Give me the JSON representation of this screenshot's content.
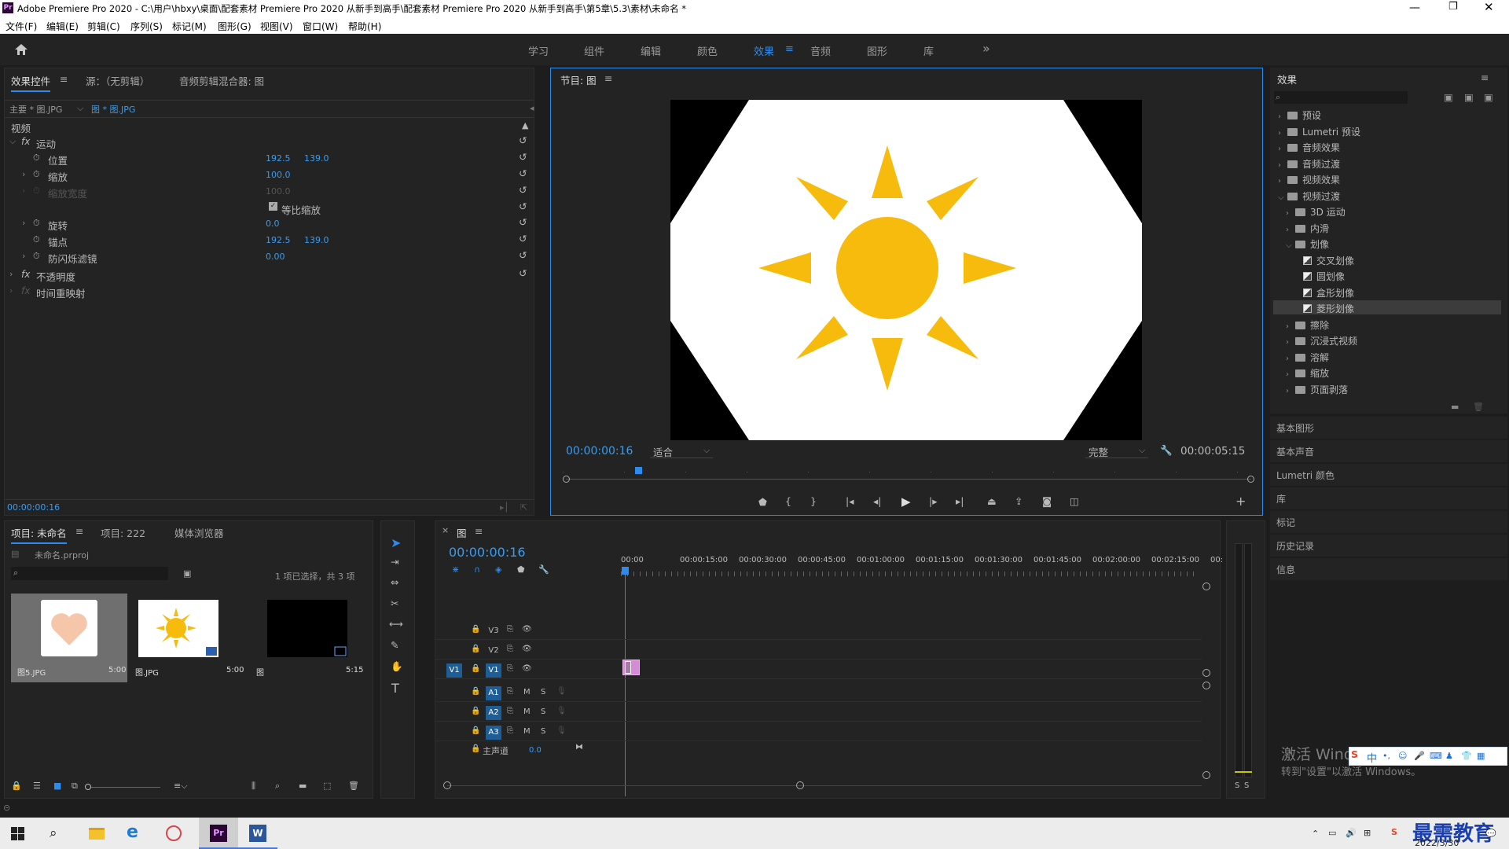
{
  "window": {
    "title": "Adobe Premiere Pro 2020 - C:\\用户\\hbxy\\桌面\\配套素材 Premiere Pro 2020 从新手到高手\\配套素材 Premiere Pro 2020 从新手到高手\\第5章\\5.3\\素材\\未命名 *",
    "app_icon": "Pr"
  },
  "menu": [
    "文件(F)",
    "编辑(E)",
    "剪辑(C)",
    "序列(S)",
    "标记(M)",
    "图形(G)",
    "视图(V)",
    "窗口(W)",
    "帮助(H)"
  ],
  "workspaces": [
    "学习",
    "组件",
    "编辑",
    "颜色",
    "效果",
    "音频",
    "图形",
    "库"
  ],
  "workspaces_more": "»",
  "effect_controls": {
    "tabs": [
      "效果控件",
      "源：（无剪辑）",
      "音频剪辑混合器: 图"
    ],
    "master": "主要 * 图.JPG",
    "clip": "图 * 图.JPG",
    "video_label": "视频",
    "motion_label": "运动",
    "props": [
      {
        "name": "位置",
        "v1": "192.5",
        "v2": "139.0"
      },
      {
        "name": "缩放",
        "v1": "100.0",
        "v2": ""
      },
      {
        "name": "缩放宽度",
        "v1": "100.0",
        "v2": ""
      },
      {
        "name": "等比缩放",
        "v1": "",
        "v2": ""
      },
      {
        "name": "旋转",
        "v1": "0.0",
        "v2": ""
      },
      {
        "name": "锚点",
        "v1": "192.5",
        "v2": "139.0"
      },
      {
        "name": "防闪烁滤镜",
        "v1": "0.00",
        "v2": ""
      }
    ],
    "opacity_label": "不透明度",
    "timeremap_label": "时间重映射",
    "timecode": "00:00:00:16"
  },
  "program": {
    "tab": "节目: 图",
    "timecode": "00:00:00:16",
    "fit": "适合",
    "quality": "完整",
    "duration": "00:00:05:15"
  },
  "effects": {
    "title": "效果",
    "search_placeholder": "",
    "tree": [
      {
        "label": "预设",
        "level": 0,
        "kind": "folder",
        "open": false
      },
      {
        "label": "Lumetri 预设",
        "level": 0,
        "kind": "folder",
        "open": false
      },
      {
        "label": "音频效果",
        "level": 0,
        "kind": "folder",
        "open": false
      },
      {
        "label": "音频过渡",
        "level": 0,
        "kind": "folder",
        "open": false
      },
      {
        "label": "视频效果",
        "level": 0,
        "kind": "folder",
        "open": false
      },
      {
        "label": "视频过渡",
        "level": 0,
        "kind": "folder",
        "open": true
      },
      {
        "label": "3D 运动",
        "level": 1,
        "kind": "folder",
        "open": false
      },
      {
        "label": "内滑",
        "level": 1,
        "kind": "folder",
        "open": false
      },
      {
        "label": "划像",
        "level": 1,
        "kind": "folder",
        "open": true
      },
      {
        "label": "交叉划像",
        "level": 2,
        "kind": "fx",
        "open": false
      },
      {
        "label": "圆划像",
        "level": 2,
        "kind": "fx",
        "open": false
      },
      {
        "label": "盒形划像",
        "level": 2,
        "kind": "fx",
        "open": false
      },
      {
        "label": "菱形划像",
        "level": 2,
        "kind": "fx",
        "open": false,
        "selected": true
      },
      {
        "label": "擦除",
        "level": 1,
        "kind": "folder",
        "open": false
      },
      {
        "label": "沉浸式视频",
        "level": 1,
        "kind": "folder",
        "open": false
      },
      {
        "label": "溶解",
        "level": 1,
        "kind": "folder",
        "open": false
      },
      {
        "label": "缩放",
        "level": 1,
        "kind": "folder",
        "open": false
      },
      {
        "label": "页面剥落",
        "level": 1,
        "kind": "folder",
        "open": false
      }
    ],
    "panels": [
      "基本图形",
      "基本声音",
      "Lumetri 颜色",
      "库",
      "标记",
      "历史记录",
      "信息"
    ]
  },
  "project": {
    "tabs": [
      "项目: 未命名",
      "项目: 222",
      "媒体浏览器"
    ],
    "file": "未命名.prproj",
    "selection": "1 项已选择，共 3 项",
    "items": [
      {
        "name": "图5.JPG",
        "dur": "5:00"
      },
      {
        "name": "图.JPG",
        "dur": "5:00"
      },
      {
        "name": "图",
        "dur": "5:15"
      }
    ]
  },
  "timeline": {
    "tab": "图",
    "timecode": "00:00:00:16",
    "ruler": [
      "00:00",
      "00:00:15:00",
      "00:00:30:00",
      "00:00:45:00",
      "00:01:00:00",
      "00:01:15:00",
      "00:01:30:00",
      "00:01:45:00",
      "00:02:00:00",
      "00:02:15:00",
      "00:"
    ],
    "video_tracks": [
      "V3",
      "V2",
      "V1"
    ],
    "audio_tracks": [
      "A1",
      "A2",
      "A3"
    ],
    "source_v": "V1",
    "master_label": "主声道",
    "master_value": "0.0",
    "mute": "M",
    "solo": "S"
  },
  "meter": {
    "s1": "S",
    "s2": "S"
  },
  "watermark": {
    "line1": "激活 Windows",
    "line2": "转到\"设置\"以激活 Windows。"
  },
  "ime": {
    "lang": "中"
  },
  "brand": "最需教育",
  "clock": {
    "time": "",
    "date": "2022/3/30"
  },
  "colors": {
    "accent": "#2d8ceb",
    "clip": "#d58bd6",
    "sun": "#f6bb0d"
  }
}
